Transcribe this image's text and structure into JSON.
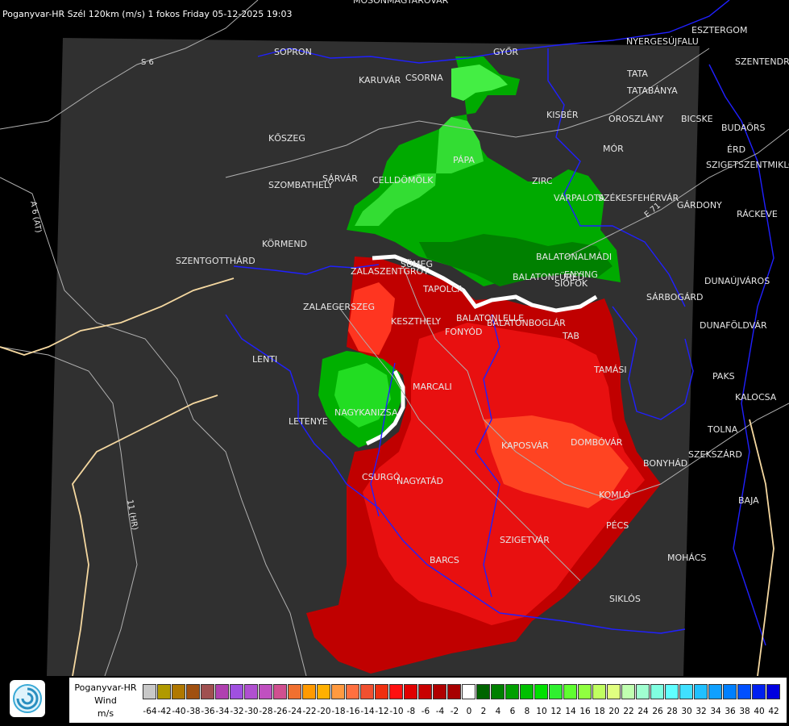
{
  "title": "Poganyvar-HR Szél 120km (m/s) 1 fokos Friday 05-12-2025 19:03",
  "colors": {
    "background": "#000000",
    "map_area": "#303030",
    "borders": "#1a1aff",
    "roads": "#b5b5b5",
    "national_border": "#f5d8a0",
    "red_dark": "#b00000",
    "red_mid": "#e01010",
    "red_light": "#ff4420",
    "green_dark": "#008a00",
    "green_mid": "#22cc22",
    "green_light": "#55ee55"
  },
  "cities": [
    "MOSONMAGYARÓVÁR",
    "SOPRON",
    "GYŐR",
    "KARUVÁR",
    "CSORNA",
    "TATA",
    "TATABÁNYA",
    "KISBÉR",
    "OROSZLÁNY",
    "BICSKE",
    "BUDAÖRS",
    "ESZTERGOM",
    "NYERGESÚJFALU",
    "SZENTENDRE",
    "ÉRD",
    "SZIGETSZENTMIKLÓS",
    "MÓR",
    "PÁPA",
    "KŐSZEG",
    "SÁRVÁR",
    "CELLDÖMÖLK",
    "SZOMBATHELY",
    "ZIRC",
    "VÁRPALOTA",
    "SZÉKESFEHÉRVÁR",
    "GÁRDONY",
    "RÁCKEVE",
    "KÖRMEND",
    "SZENTGOTTHÁRD",
    "ZALASZENTGRÓT",
    "SÜMEG",
    "TAPOLCA",
    "BALATONALMÁDI",
    "BALATONFÜRED",
    "SIÓFOK",
    "ENYING",
    "DUNAÚJVÁROS",
    "SÁRBOGÁRD",
    "ZALAEGERSZEG",
    "KESZTHELY",
    "BALATONLELLE",
    "FONYÓD",
    "BALATONBOGLÁR",
    "TAB",
    "DUNAFÖLDVÁR",
    "LENTI",
    "MARCALI",
    "TAMÁSI",
    "PAKS",
    "KALOCSA",
    "LETENYE",
    "NAGYKANIZSA",
    "TOLNA",
    "KAPOSVÁR",
    "DOMBÓVÁR",
    "SZEKSZÁRD",
    "BONYHÁD",
    "CSURGÓ",
    "NAGYATÁD",
    "KOMLÓ",
    "BAJA",
    "PÉCS",
    "SZIGETVÁR",
    "MOHÁCS",
    "BARCS",
    "SIKLÓS"
  ],
  "road_labels": [
    "S 6",
    "A 6 (AT)",
    "11 (HR)",
    "E 71"
  ],
  "legend": {
    "radar_name": "Poganyvar-HR",
    "quantity": "Wind",
    "unit": "m/s",
    "ticks": [
      "-64",
      "-42",
      "-40",
      "-38",
      "-36",
      "-34",
      "-32",
      "-30",
      "-28",
      "-26",
      "-24",
      "-22",
      "-20",
      "-18",
      "-16",
      "-14",
      "-12",
      "-10",
      "-8",
      "-6",
      "-4",
      "-2",
      "0",
      "2",
      "4",
      "6",
      "8",
      "10",
      "12",
      "14",
      "16",
      "18",
      "20",
      "22",
      "24",
      "26",
      "28",
      "30",
      "32",
      "34",
      "36",
      "38",
      "40",
      "42"
    ],
    "swatch_colors": [
      "#c8c8c8",
      "#b09a00",
      "#b07800",
      "#a05010",
      "#a05050",
      "#b040b0",
      "#a050e0",
      "#b050d0",
      "#c050c0",
      "#d05090",
      "#f07030",
      "#ff9a00",
      "#ffb000",
      "#ff9a40",
      "#ff7040",
      "#f05030",
      "#f03010",
      "#ff1010",
      "#e00000",
      "#c80000",
      "#b00000",
      "#a80000",
      "#ffffff",
      "#006400",
      "#008000",
      "#00a000",
      "#00c000",
      "#00e000",
      "#30f030",
      "#60ff30",
      "#90ff40",
      "#c0ff60",
      "#e0ff80",
      "#c0ffb0",
      "#a0ffd0",
      "#80ffe0",
      "#60ffff",
      "#40e0ff",
      "#20c0ff",
      "#10a0ff",
      "#0080ff",
      "#0050ff",
      "#0020f0",
      "#0000e0"
    ]
  }
}
